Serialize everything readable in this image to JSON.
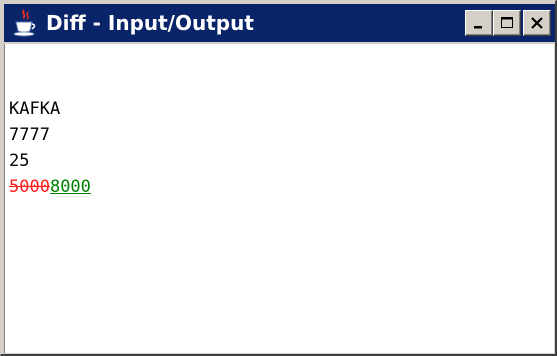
{
  "window": {
    "title": "Diff - Input/Output"
  },
  "icons": {
    "app": "java-cup-icon",
    "minimize": "minimize-icon",
    "maximize": "maximize-icon",
    "close": "close-icon"
  },
  "colors": {
    "titlebar": "#0a246a",
    "deleted": "#ff2020",
    "inserted": "#008000"
  },
  "diff": {
    "lines": [
      "KAFKA",
      "7777",
      "25"
    ],
    "changed_line": {
      "deleted": "5000",
      "inserted": "8000"
    }
  }
}
